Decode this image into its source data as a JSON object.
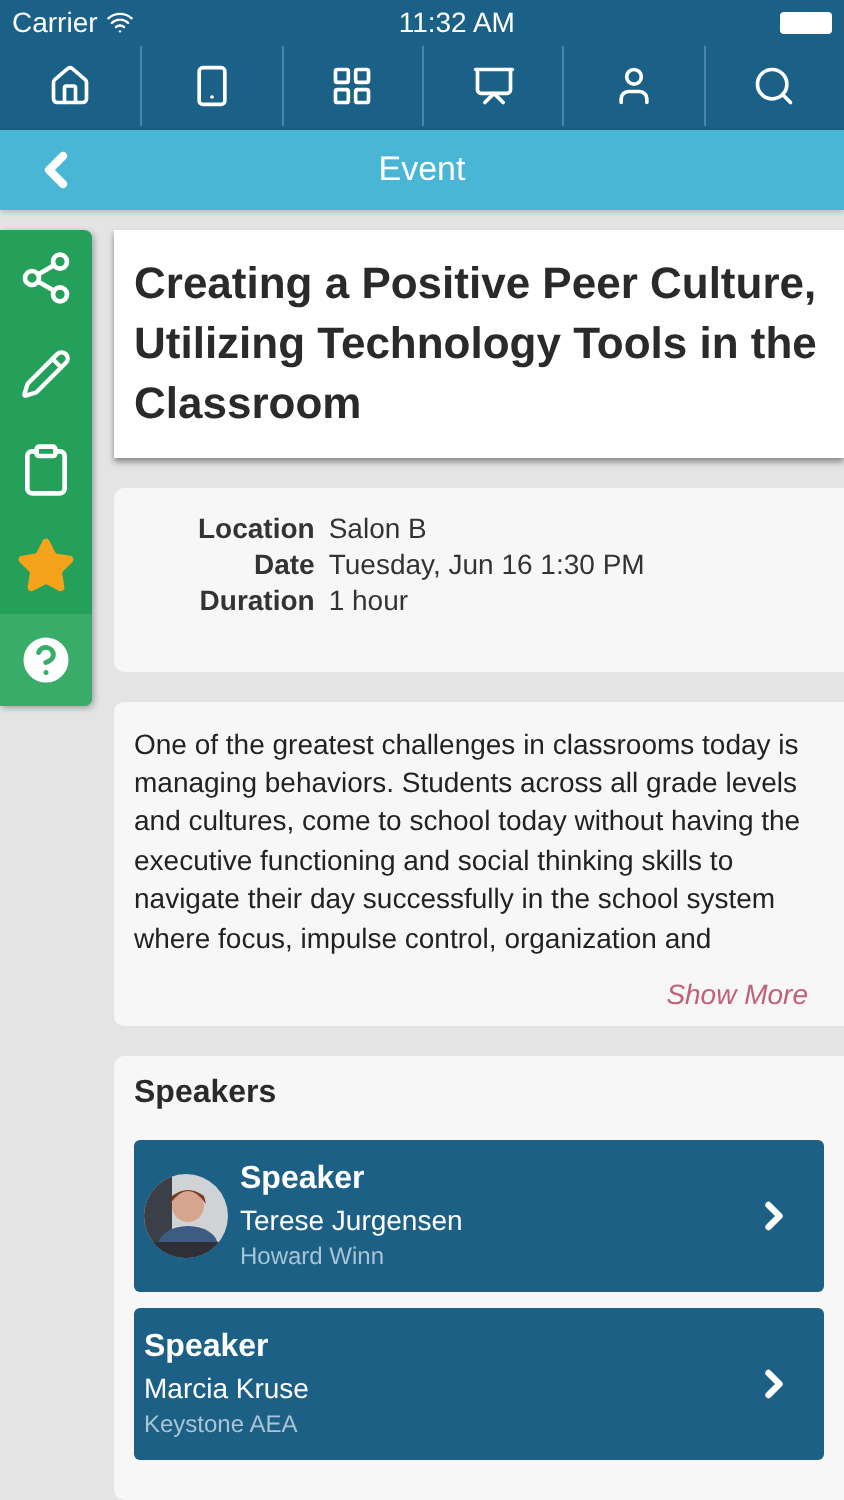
{
  "status_bar": {
    "carrier": "Carrier",
    "time": "11:32 AM"
  },
  "nav_tabs": [
    {
      "kind": "home"
    },
    {
      "kind": "kiosk"
    },
    {
      "kind": "grid"
    },
    {
      "kind": "easel"
    },
    {
      "kind": "person"
    },
    {
      "kind": "search"
    }
  ],
  "header": {
    "title": "Event"
  },
  "side_actions": [
    {
      "kind": "share"
    },
    {
      "kind": "edit"
    },
    {
      "kind": "notes"
    },
    {
      "kind": "favorite"
    },
    {
      "kind": "help"
    }
  ],
  "event": {
    "title": "Creating a Positive Peer Culture, Utilizing Technology Tools in the Classroom",
    "details": [
      {
        "label": "Location",
        "value": "Salon B"
      },
      {
        "label": "Date",
        "value": "Tuesday, Jun 16 1:30 PM"
      },
      {
        "label": "Duration",
        "value": "1 hour"
      }
    ],
    "description": "One of the greatest challenges in classrooms today is managing behaviors. Students across all grade levels and cultures, come to school today without having the executive functioning and social thinking skills to navigate their day successfully in the school system where focus, impulse control, organization and",
    "show_more": "Show More"
  },
  "speakers": {
    "heading": "Speakers",
    "items": [
      {
        "role": "Speaker",
        "name": "Terese Jurgensen",
        "organization": "Howard Winn"
      },
      {
        "kind": "plain",
        "role": "Speaker",
        "name": "Marcia Kruse",
        "organization": "Keystone AEA"
      }
    ]
  }
}
